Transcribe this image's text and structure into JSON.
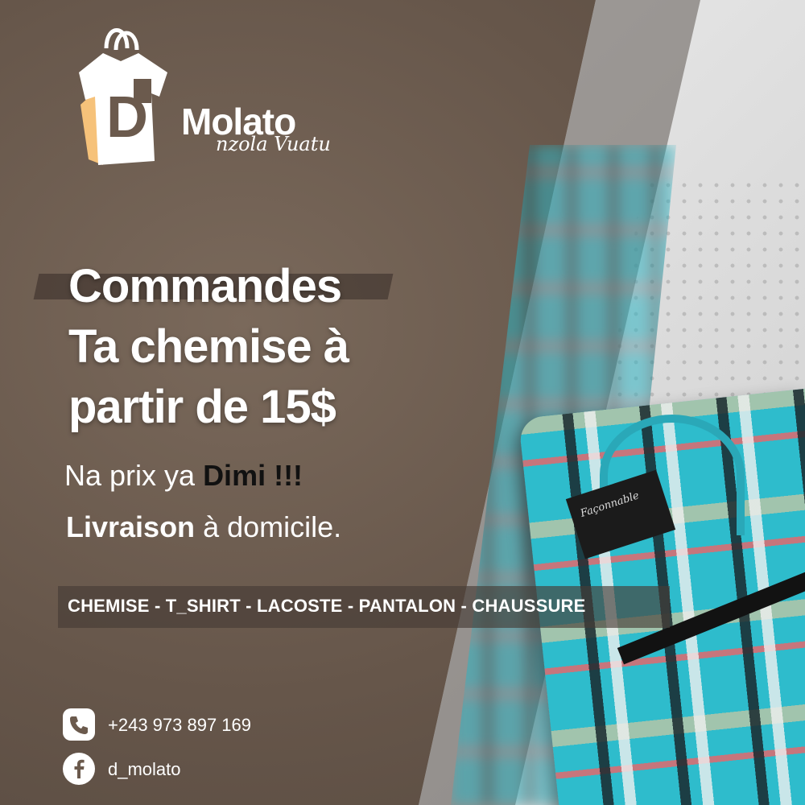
{
  "brand": {
    "name": "Molato",
    "tagline": "nzola Vuatu",
    "logo_icon": "shopping-bag-shirt-icon",
    "logo_letter": "D"
  },
  "headline": [
    "Commandes",
    "Ta chemise à",
    "partir de 15$"
  ],
  "promo": {
    "prefix": "Na prix ya ",
    "highlight": "Dimi !!!"
  },
  "delivery": {
    "highlight": "Livraison",
    "suffix": " à domicile."
  },
  "categories": "CHEMISE - T_SHIRT - LACOSTE - PANTALON - CHAUSSURE",
  "contacts": {
    "phone": {
      "icon": "phone-icon",
      "value": "+243 973 897 169"
    },
    "facebook": {
      "icon": "facebook-icon",
      "value": "d_molato"
    }
  },
  "product": {
    "label_text": "Façonnable"
  },
  "colors": {
    "background": "#6b5a4d",
    "accent_orange": "#f6c27a",
    "shirt_blue": "#2ebccc",
    "text": "#ffffff"
  }
}
